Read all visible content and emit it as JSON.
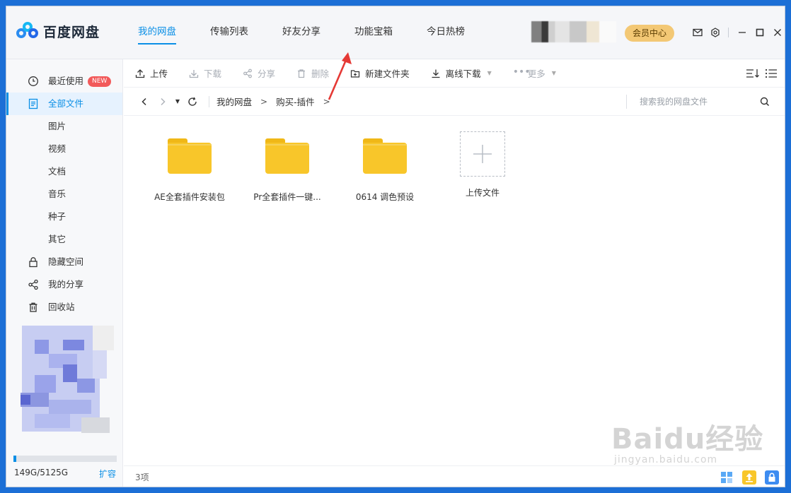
{
  "app": {
    "name": "百度网盘"
  },
  "top_nav": [
    {
      "label": "我的网盘",
      "active": true
    },
    {
      "label": "传输列表",
      "active": false
    },
    {
      "label": "好友分享",
      "active": false
    },
    {
      "label": "功能宝箱",
      "active": false
    },
    {
      "label": "今日热榜",
      "active": false
    }
  ],
  "header": {
    "vip_label": "会员中心",
    "icons": [
      "mail-icon",
      "settings-icon"
    ]
  },
  "window_controls": [
    "minimize-icon",
    "maximize-icon",
    "close-icon"
  ],
  "sidebar": {
    "items": [
      {
        "label": "最近使用",
        "icon": "clock-icon",
        "badge": "NEW"
      },
      {
        "label": "全部文件",
        "icon": "document-icon",
        "active": true
      },
      {
        "label": "图片"
      },
      {
        "label": "视频"
      },
      {
        "label": "文档"
      },
      {
        "label": "音乐"
      },
      {
        "label": "种子"
      },
      {
        "label": "其它"
      },
      {
        "label": "隐藏空间",
        "icon": "lock-icon"
      },
      {
        "label": "我的分享",
        "icon": "share-icon"
      },
      {
        "label": "回收站",
        "icon": "trash-icon"
      }
    ],
    "quota_text": "149G/5125G",
    "quota_fraction": 0.029,
    "expand_label": "扩容"
  },
  "toolbar": {
    "upload": "上传",
    "download": "下载",
    "share": "分享",
    "delete": "删除",
    "new_folder": "新建文件夹",
    "offline_download": "离线下载",
    "more": "更多"
  },
  "path": {
    "segments": [
      "我的网盘",
      "购买-插件"
    ],
    "separator": ">"
  },
  "search": {
    "placeholder": "搜索我的网盘文件"
  },
  "files": [
    {
      "name": "AE全套插件安装包",
      "type": "folder"
    },
    {
      "name": "Pr全套插件一键...",
      "type": "folder"
    },
    {
      "name": "0614 调色预设",
      "type": "folder"
    }
  ],
  "upload_tile": {
    "label": "上传文件"
  },
  "status": {
    "count": "3项"
  },
  "colors": {
    "accent": "#0a8fe6",
    "folder": "#f8c62a",
    "vip": "#f3c875",
    "badge": "#f25a5a"
  },
  "watermark": {
    "brand": "Baidu经验",
    "url": "jingyan.baidu.com"
  }
}
